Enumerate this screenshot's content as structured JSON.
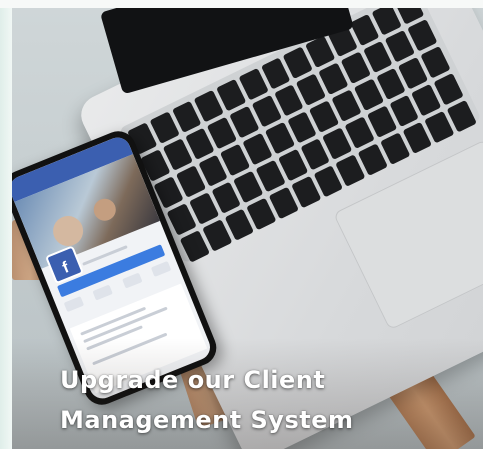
{
  "caption": {
    "line1": "Upgrade our Client",
    "line2": "Management System"
  },
  "phone": {
    "app_icon_letter": "f"
  },
  "colors": {
    "facebook_blue": "#3b5fb0",
    "caption_text": "#ffffff",
    "wood": "#c08a60"
  }
}
